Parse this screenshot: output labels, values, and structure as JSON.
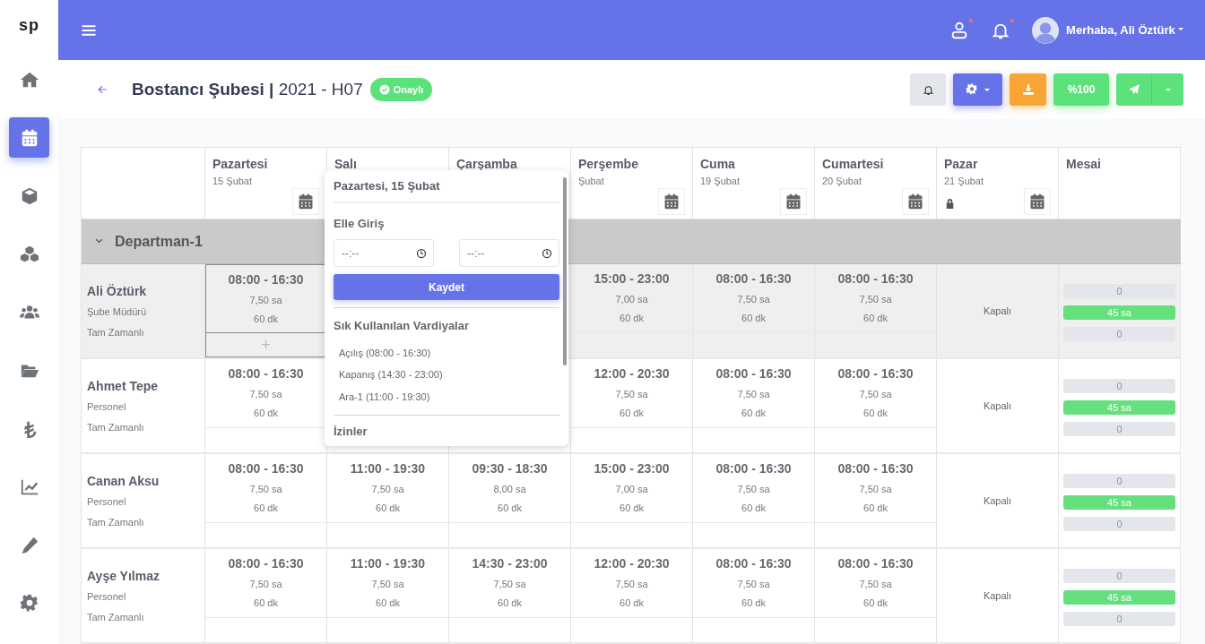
{
  "sidebar": {
    "logo": "sp",
    "items": [
      {
        "selected": false
      },
      {
        "selected": true
      },
      {
        "selected": false
      },
      {
        "selected": false
      },
      {
        "selected": false
      },
      {
        "selected": false
      },
      {
        "selected": false
      },
      {
        "selected": false
      },
      {
        "selected": false
      },
      {
        "selected": false
      }
    ]
  },
  "topbar": {
    "user_menu": "Merhaba, Ali Öztürk",
    "user_alert": true,
    "bell_alert": true
  },
  "page_header": {
    "title": "**Bostancı Şubesi |** 2021 - H07",
    "status_badge": "Onaylı",
    "toolbar": [
      {
        "kind": "bell"
      },
      {
        "kind": "settings"
      },
      {
        "kind": "download"
      },
      {
        "kind": "text",
        "label": "%100"
      },
      {
        "kind": "send"
      }
    ]
  },
  "schedule": {
    "days": [
      {
        "name": "Pazartesi",
        "date": "15 Şubat",
        "locked": false,
        "calendar_button": true
      },
      {
        "name": "Salı",
        "locked": false,
        "calendar_button": false
      },
      {
        "name": "Çarşamba",
        "locked": false,
        "calendar_button": false
      },
      {
        "name": "Perşembe",
        "date": "Şubat",
        "locked": false,
        "calendar_button": true
      },
      {
        "name": "Cuma",
        "date": "19 Şubat",
        "locked": false,
        "calendar_button": true
      },
      {
        "name": "Cumartesi",
        "date": "20 Şubat",
        "locked": false,
        "calendar_button": true
      },
      {
        "name": "Pazar",
        "date": "21 Şubat",
        "locked": true,
        "calendar_button": true
      }
    ],
    "summary_column": "Mesai",
    "department": {
      "name": "Departman-1",
      "expanded": true
    },
    "employees": [
      {
        "name": "Ali Öztürk",
        "role": "Şube Müdürü",
        "type": "Tam Zamanlı",
        "selected": true,
        "closed_label": "Kapalı",
        "shifts": [
          {
            "kind": "shift",
            "time": "08:00 - 16:30",
            "hours": "7,50 sa",
            "break": "60 dk",
            "selected": true,
            "add_label": "+"
          },
          {
            "kind": "covered"
          },
          {
            "kind": "covered"
          },
          {
            "time": "15:00 - 23:00",
            "hours": "7,00 sa",
            "break": "60 dk",
            "selected": false
          },
          {
            "time": "08:00 - 16:30",
            "hours": "7,50 sa",
            "break": "60 dk",
            "selected": false
          },
          {
            "time": "08:00 - 16:30",
            "hours": "7,50 sa",
            "break": "60 dk",
            "selected": false
          }
        ],
        "totals": [
          {
            "text": "0",
            "kind": "empty"
          },
          {
            "text": "45 sa",
            "kind": "filled"
          },
          {
            "text": "0",
            "kind": "empty"
          }
        ]
      },
      {
        "name": "Ahmet Tepe",
        "role": "Personel",
        "type": "Tam Zamanlı",
        "selected": false,
        "closed_label": "Kapalı",
        "shifts": [
          {
            "time": "08:00 - 16:30",
            "hours": "7,50 sa",
            "break": "60 dk",
            "selected": false
          },
          {
            "kind": "covered"
          },
          {
            "kind": "covered"
          },
          {
            "time": "12:00 - 20:30",
            "hours": "7,50 sa",
            "break": "60 dk",
            "selected": false
          },
          {
            "time": "08:00 - 16:30",
            "hours": "7,50 sa",
            "break": "60 dk",
            "selected": false
          },
          {
            "time": "08:00 - 16:30",
            "hours": "7,50 sa",
            "break": "60 dk",
            "selected": false
          }
        ],
        "totals": [
          {
            "text": "0",
            "kind": "empty"
          },
          {
            "text": "45 sa",
            "kind": "filled"
          },
          {
            "text": "0",
            "kind": "empty"
          }
        ]
      },
      {
        "name": "Canan Aksu",
        "role": "Personel",
        "type": "Tam Zamanlı",
        "selected": false,
        "closed_label": "Kapalı",
        "shifts": [
          {
            "time": "08:00 - 16:30",
            "hours": "7,50 sa",
            "break": "60 dk",
            "selected": false
          },
          {
            "time": "11:00 - 19:30",
            "hours": "7,50 sa",
            "break": "60 dk",
            "selected": false
          },
          {
            "time": "09:30 - 18:30",
            "hours": "8,00 sa",
            "break": "60 dk",
            "selected": false
          },
          {
            "time": "15:00 - 23:00",
            "hours": "7,00 sa",
            "break": "60 dk",
            "selected": false
          },
          {
            "time": "08:00 - 16:30",
            "hours": "7,50 sa",
            "break": "60 dk",
            "selected": false
          },
          {
            "time": "08:00 - 16:30",
            "hours": "7,50 sa",
            "break": "60 dk",
            "selected": false
          }
        ],
        "totals": [
          {
            "text": "0",
            "kind": "empty"
          },
          {
            "text": "45 sa",
            "kind": "filled"
          },
          {
            "text": "0",
            "kind": "empty"
          }
        ]
      },
      {
        "name": "Ayşe Yılmaz",
        "role": "Personel",
        "type": "Tam Zamanlı",
        "selected": false,
        "closed_label": "Kapalı",
        "shifts": [
          {
            "time": "08:00 - 16:30",
            "hours": "7,50 sa",
            "break": "60 dk",
            "selected": false
          },
          {
            "time": "11:00 - 19:30",
            "hours": "7,50 sa",
            "break": "60 dk",
            "selected": false
          },
          {
            "time": "14:30 - 23:00",
            "hours": "7,50 sa",
            "break": "60 dk",
            "selected": false
          },
          {
            "time": "12:00 - 20:30",
            "hours": "7,50 sa",
            "break": "60 dk",
            "selected": false
          },
          {
            "time": "08:00 - 16:30",
            "hours": "7,50 sa",
            "break": "60 dk",
            "selected": false
          },
          {
            "time": "08:00 - 16:30",
            "hours": "7,50 sa",
            "break": "60 dk",
            "selected": false
          }
        ],
        "totals": [
          {
            "text": "0",
            "kind": "empty"
          },
          {
            "text": "45 sa",
            "kind": "filled"
          },
          {
            "text": "0",
            "kind": "empty"
          }
        ]
      }
    ]
  },
  "shift_popover": {
    "title": "Pazartesi, 15 Şubat",
    "manual_heading": "Elle Giriş",
    "start_input": {
      "placeholder": "--:--"
    },
    "end_input": {
      "placeholder": "--:--"
    },
    "save_button": "Kaydet",
    "favorites_heading": "Sık Kullanılan Vardiyalar",
    "favorites": [
      "Açılış (08:00 - 16:30)",
      "Kapanış (14:30 - 23:00)",
      "Ara-1 (11:00 - 19:30)"
    ],
    "leave_heading": "İzinler"
  }
}
